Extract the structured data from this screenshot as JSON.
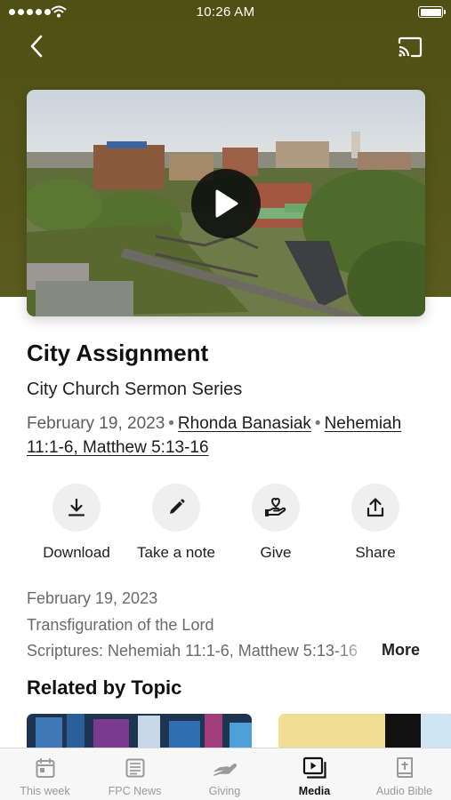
{
  "status_bar": {
    "time": "10:26 AM"
  },
  "sermon": {
    "title": "City Assignment",
    "series": "City Church Sermon Series",
    "date": "February 19, 2023",
    "speaker": "Rhonda Banasiak",
    "passage_line1": "Nehemiah",
    "passage_line2": "11:1-6, Matthew 5:13-16"
  },
  "actions": [
    {
      "label": "Download",
      "icon": "download-icon"
    },
    {
      "label": "Take a note",
      "icon": "pencil-icon"
    },
    {
      "label": "Give",
      "icon": "heart-hand-icon"
    },
    {
      "label": "Share",
      "icon": "share-icon"
    }
  ],
  "description": {
    "date": "February 19, 2023",
    "occasion": "Transfiguration of the Lord",
    "scriptures": "Scriptures: Nehemiah 11:1-6, Matthew 5:13-16",
    "more_label": "More"
  },
  "related": {
    "title": "Related by Topic"
  },
  "tabs": [
    {
      "label": "This week",
      "icon": "calendar-icon",
      "active": false
    },
    {
      "label": "FPC News",
      "icon": "newspaper-icon",
      "active": false
    },
    {
      "label": "Giving",
      "icon": "giving-hand-icon",
      "active": false
    },
    {
      "label": "Media",
      "icon": "media-play-icon",
      "active": true
    },
    {
      "label": "Audio Bible",
      "icon": "bible-icon",
      "active": false
    }
  ],
  "colors": {
    "header": "#55561a",
    "accent_text": "#111111",
    "muted_text": "#6a6a6a"
  }
}
